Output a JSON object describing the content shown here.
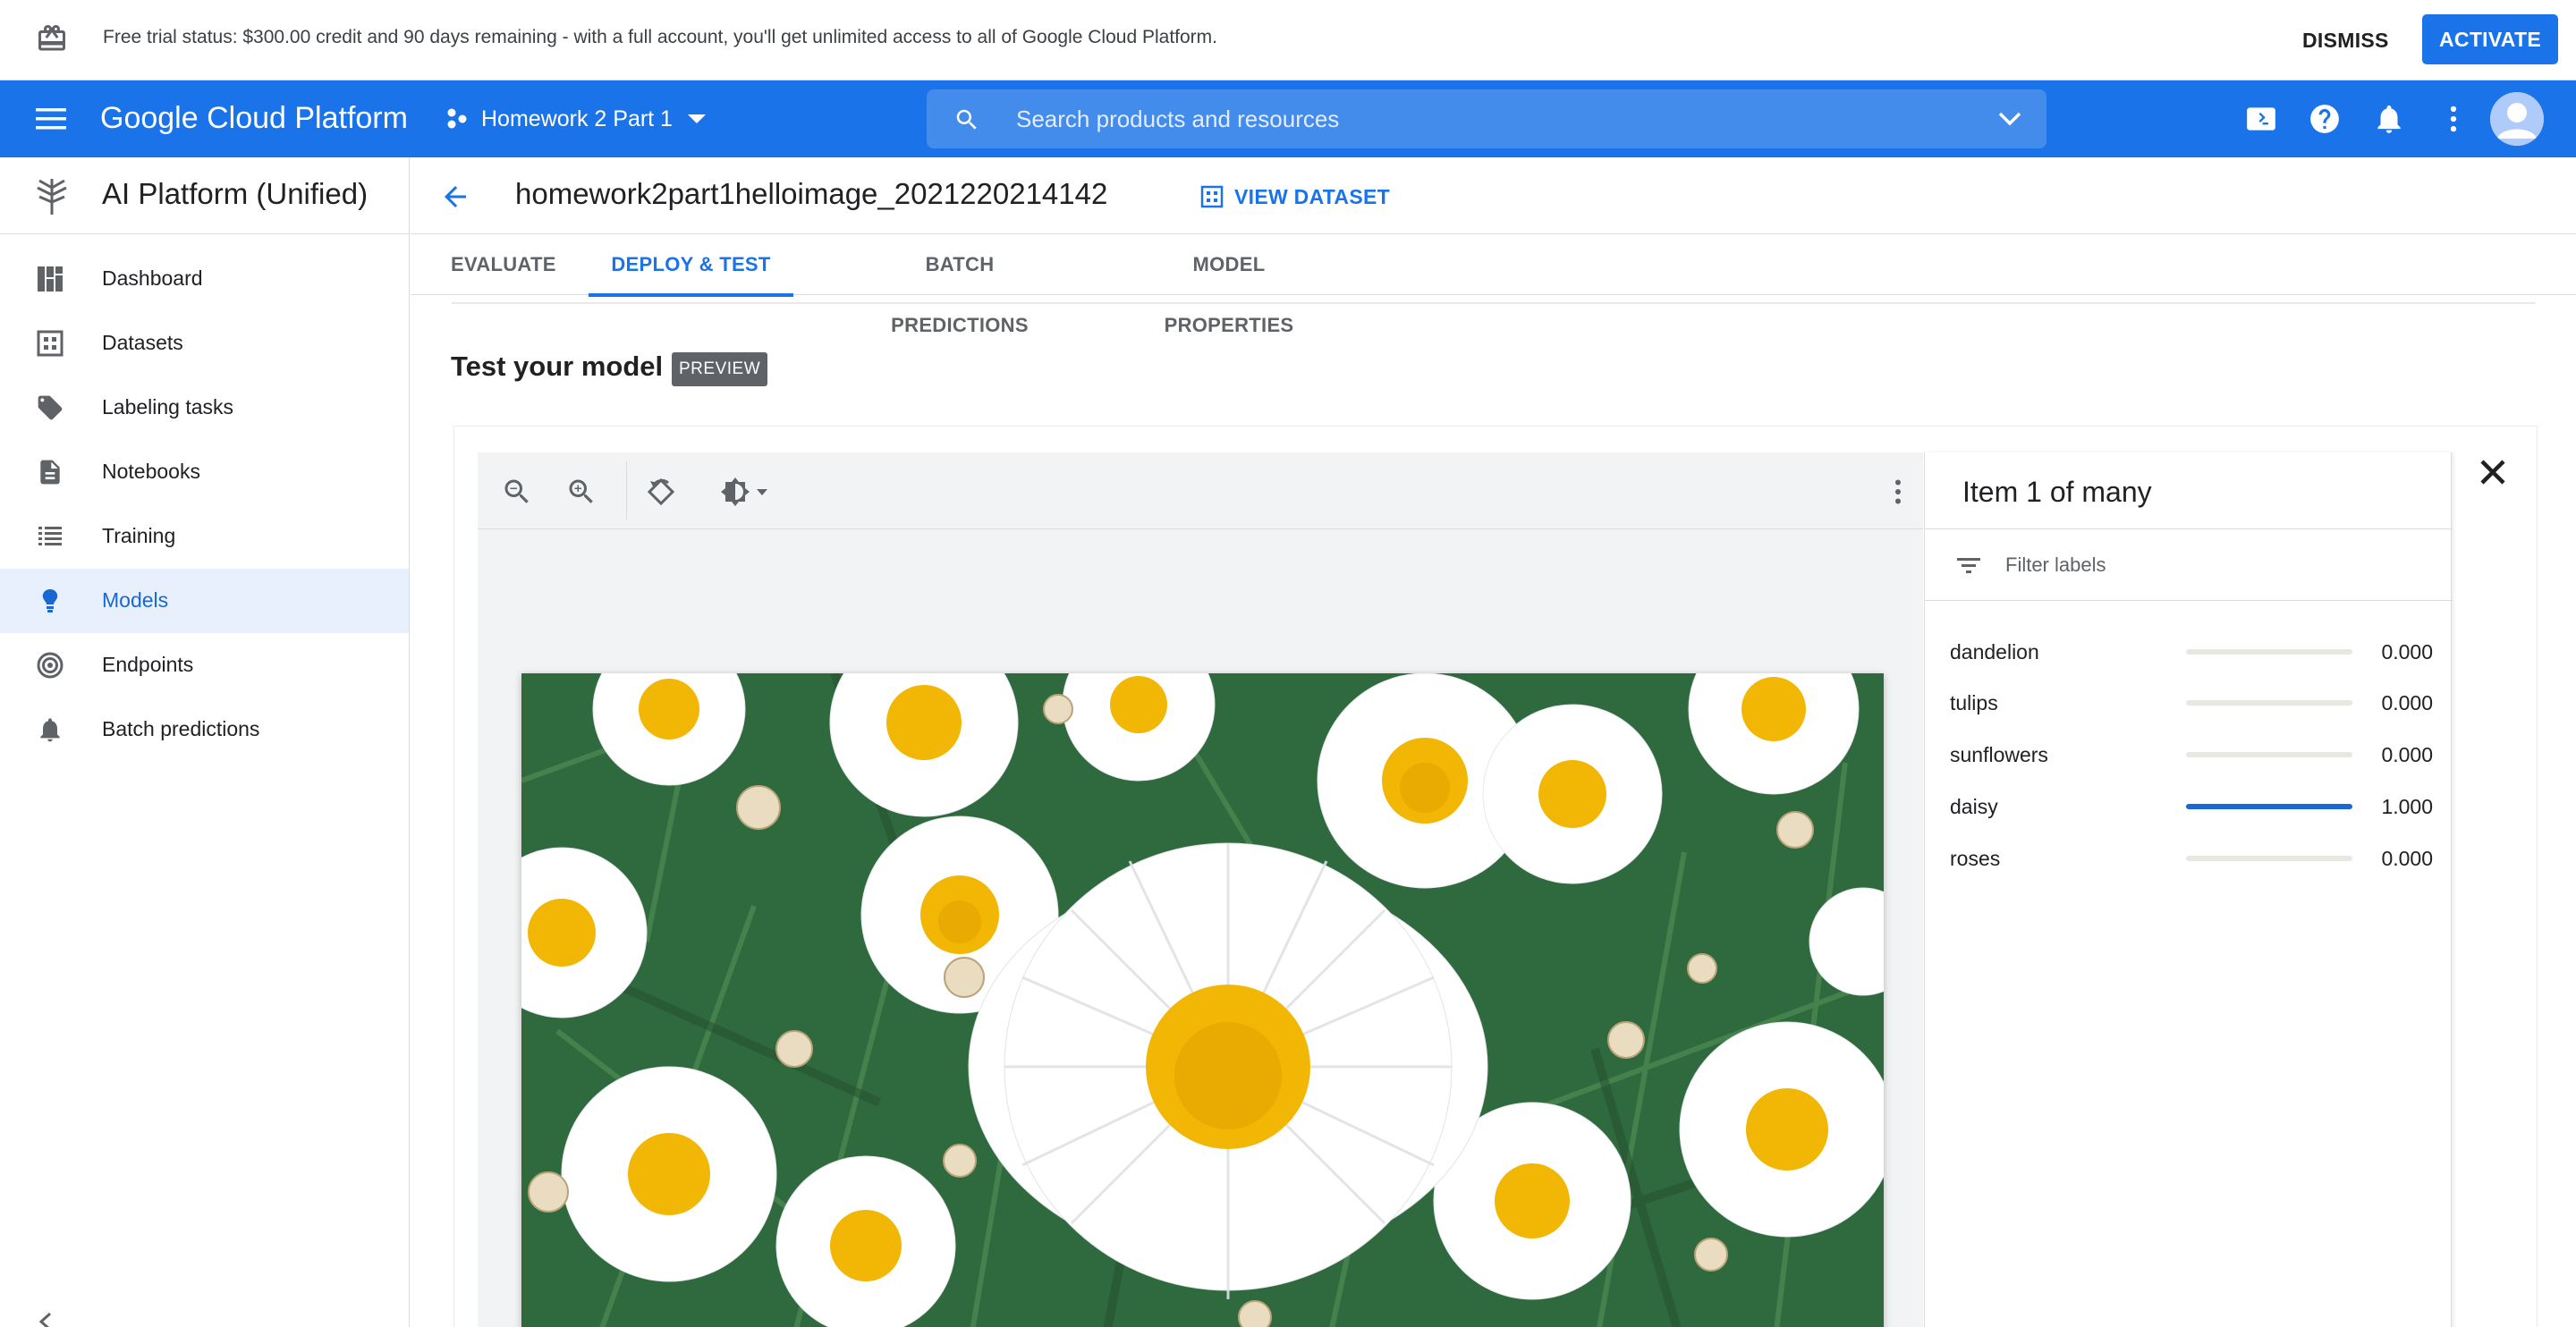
{
  "banner": {
    "icon": "gift-icon",
    "message": "Free trial status: $300.00 credit and 90 days remaining - with a full account, you'll get unlimited access to all of Google Cloud Platform.",
    "dismiss_label": "DISMISS",
    "activate_label": "ACTIVATE"
  },
  "topbar": {
    "brand": "Google Cloud Platform",
    "project": "Homework 2 Part 1",
    "search_placeholder": "Search products and resources",
    "icons": [
      "cloud-shell-icon",
      "help-icon",
      "notifications-icon",
      "more-vert-icon",
      "avatar"
    ]
  },
  "sidebar": {
    "product_title": "AI Platform (Unified)",
    "items": [
      {
        "label": "Dashboard",
        "icon": "dashboard-icon",
        "active": false
      },
      {
        "label": "Datasets",
        "icon": "datasets-icon",
        "active": false
      },
      {
        "label": "Labeling tasks",
        "icon": "label-tag-icon",
        "active": false
      },
      {
        "label": "Notebooks",
        "icon": "notebook-icon",
        "active": false
      },
      {
        "label": "Training",
        "icon": "training-list-icon",
        "active": false
      },
      {
        "label": "Models",
        "icon": "lightbulb-icon",
        "active": true
      },
      {
        "label": "Endpoints",
        "icon": "endpoints-icon",
        "active": false
      },
      {
        "label": "Batch predictions",
        "icon": "bell-icon",
        "active": false
      }
    ]
  },
  "main": {
    "title": "homework2part1helloimage_2021220214142",
    "view_dataset_label": "VIEW DATASET",
    "tabs": [
      {
        "label": "EVALUATE",
        "active": false
      },
      {
        "label": "DEPLOY & TEST",
        "active": true
      },
      {
        "label": "BATCH PREDICTIONS",
        "active": false
      },
      {
        "label": "MODEL PROPERTIES",
        "active": false
      }
    ],
    "section_title": "Test your model",
    "preview_badge": "PREVIEW"
  },
  "viewer": {
    "tools": [
      "zoom-out-icon",
      "zoom-in-icon",
      "reset-rotate-icon",
      "brightness-icon",
      "more-vert-icon"
    ]
  },
  "labels_panel": {
    "title": "Item 1 of many",
    "filter_placeholder": "Filter labels",
    "rows": [
      {
        "name": "dandelion",
        "value": "0.000",
        "score": 0.0
      },
      {
        "name": "tulips",
        "value": "0.000",
        "score": 0.0
      },
      {
        "name": "sunflowers",
        "value": "0.000",
        "score": 0.0
      },
      {
        "name": "daisy",
        "value": "1.000",
        "score": 1.0
      },
      {
        "name": "roses",
        "value": "0.000",
        "score": 0.0
      }
    ]
  },
  "colors": {
    "primary": "#1a73e8",
    "active_nav_bg": "#e8f0fe",
    "bar_fill": "#1967d2"
  }
}
